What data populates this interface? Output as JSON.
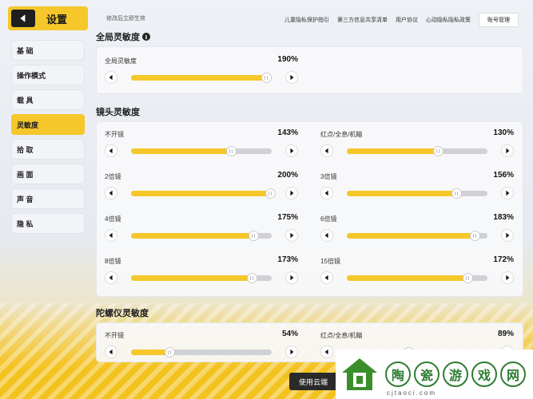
{
  "sidebar": {
    "title": "设置",
    "items": [
      {
        "label": "基 础",
        "active": false
      },
      {
        "label": "操作模式",
        "active": false
      },
      {
        "label": "载 具",
        "active": false
      },
      {
        "label": "灵敏度",
        "active": true
      },
      {
        "label": "拾 取",
        "active": false
      },
      {
        "label": "画 面",
        "active": false
      },
      {
        "label": "声 音",
        "active": false
      },
      {
        "label": "隐 私",
        "active": false
      }
    ]
  },
  "topbar": {
    "note": "修改后立即生效",
    "links": [
      "儿童隐私保护指引",
      "第三方信息共享清单",
      "用户协议",
      "心动隐私隐私政策"
    ],
    "account_label": "账号管理"
  },
  "sections": {
    "global": {
      "title": "全局灵敏度",
      "slider": {
        "label": "全局灵敏度",
        "value": "190%",
        "fill_pct": 96
      }
    },
    "scope": {
      "title": "镜头灵敏度",
      "sliders": [
        {
          "label": "不开镜",
          "value": "143%",
          "fill_pct": 71
        },
        {
          "label": "红点/全息/机瞄",
          "value": "130%",
          "fill_pct": 65
        },
        {
          "label": "2倍镜",
          "value": "200%",
          "fill_pct": 99
        },
        {
          "label": "3倍镜",
          "value": "156%",
          "fill_pct": 78
        },
        {
          "label": "4倍镜",
          "value": "175%",
          "fill_pct": 87
        },
        {
          "label": "6倍镜",
          "value": "183%",
          "fill_pct": 91
        },
        {
          "label": "8倍镜",
          "value": "173%",
          "fill_pct": 86
        },
        {
          "label": "15倍镜",
          "value": "172%",
          "fill_pct": 86
        }
      ]
    },
    "gyro": {
      "title": "陀螺仪灵敏度",
      "sliders": [
        {
          "label": "不开镜",
          "value": "54%",
          "fill_pct": 27
        },
        {
          "label": "红点/全息/机瞄",
          "value": "89%",
          "fill_pct": 44
        }
      ]
    }
  },
  "bottom_button": "使用云端",
  "watermark": {
    "chars": [
      "陶",
      "瓷",
      "游",
      "戏",
      "网"
    ],
    "url": "cjtaoci.com"
  },
  "colors": {
    "accent": "#f5c72a",
    "dark": "#1f1f1f"
  }
}
